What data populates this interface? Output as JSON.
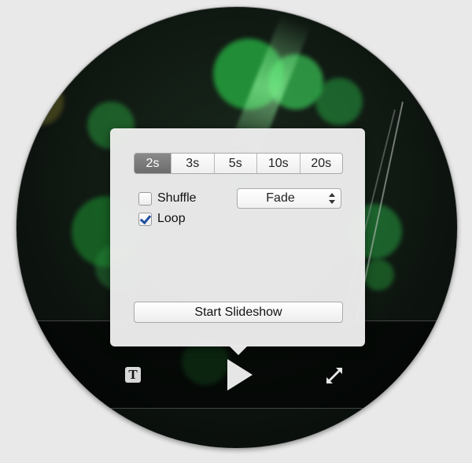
{
  "slideshow_popover": {
    "durations": [
      "2s",
      "3s",
      "5s",
      "10s",
      "20s"
    ],
    "selected_duration": "2s",
    "shuffle": {
      "label": "Shuffle",
      "checked": false
    },
    "loop": {
      "label": "Loop",
      "checked": true
    },
    "transition": {
      "value": "Fade"
    },
    "start_label": "Start Slideshow"
  },
  "controls": {
    "text_icon_glyph": "T",
    "icons": [
      "text-icon",
      "play-icon",
      "fullscreen-icon"
    ],
    "icon_color": "#e6e6e6"
  },
  "colors": {
    "selected_segment": "#7a7a7a",
    "checkmark": "#1f4fa0",
    "popover_bg": "#ececec"
  }
}
